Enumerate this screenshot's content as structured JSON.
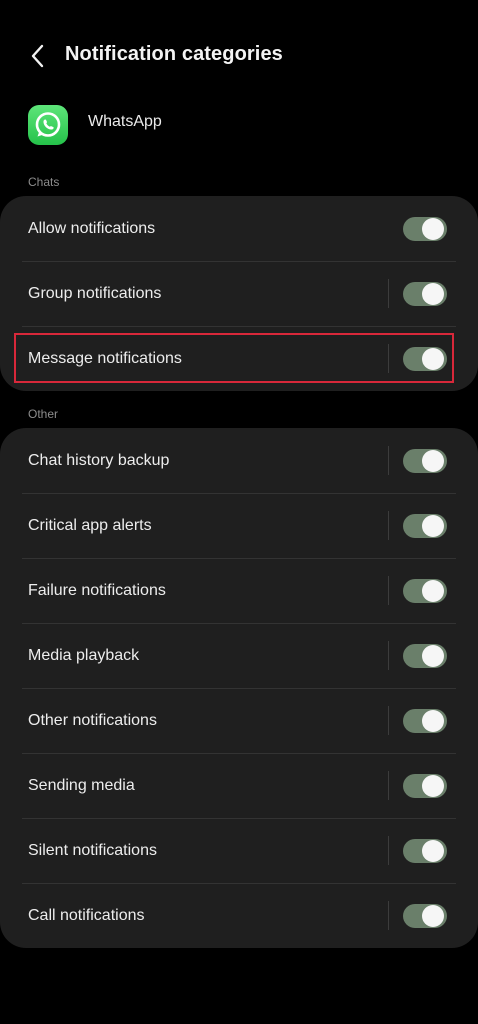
{
  "header": {
    "title": "Notification categories"
  },
  "app": {
    "name": "WhatsApp"
  },
  "sections": [
    {
      "label": "Chats",
      "items": [
        {
          "label": "Allow notifications",
          "enabled": true
        },
        {
          "label": "Group notifications",
          "enabled": true
        },
        {
          "label": "Message notifications",
          "enabled": true
        }
      ]
    },
    {
      "label": "Other",
      "items": [
        {
          "label": "Chat history backup",
          "enabled": true
        },
        {
          "label": "Critical app alerts",
          "enabled": true
        },
        {
          "label": "Failure notifications",
          "enabled": true
        },
        {
          "label": "Media playback",
          "enabled": true
        },
        {
          "label": "Other notifications",
          "enabled": true
        },
        {
          "label": "Sending media",
          "enabled": true
        },
        {
          "label": "Silent notifications",
          "enabled": true
        },
        {
          "label": "Call notifications",
          "enabled": true
        }
      ]
    }
  ],
  "colors": {
    "background": "#000000",
    "card": "#1f1f1f",
    "toggle_on": "#6a7f6a",
    "highlight": "#d8283a",
    "app_icon": "#25c24a"
  },
  "icons": {
    "back": "chevron-left-icon",
    "app": "whatsapp-icon"
  }
}
